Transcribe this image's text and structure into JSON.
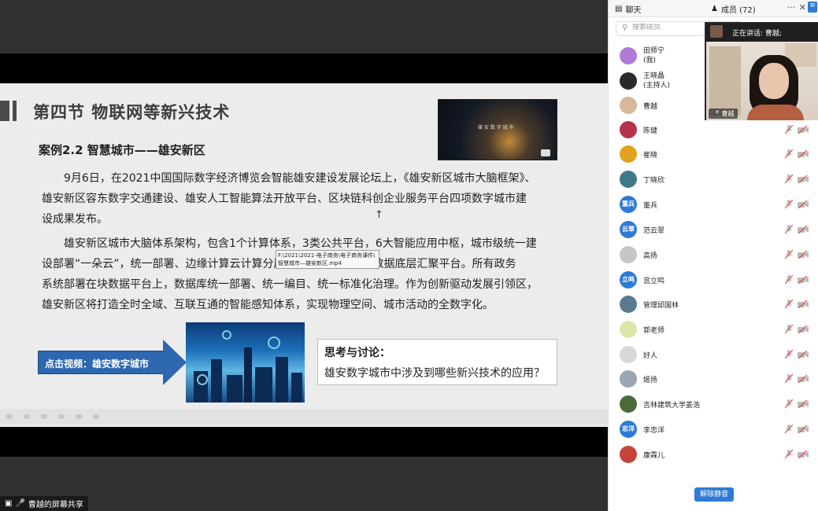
{
  "share": {
    "slide": {
      "title": "第四节 物联网等新兴技术",
      "case_title": "案例2.2  智慧城市——雄安新区",
      "para1_lines": [
        "9月6日，在2021中国国际数字经济博览会智能雄安建设发展论坛上，《雄安新区城市大脑框架》、",
        "雄安新区容东数字交通建设、雄安人工智能算法开放平台、区块链科创企业服务平台四项数字城市建",
        "设成果发布。"
      ],
      "para2_lines": [
        "雄安新区城市大脑体系架构，包含1个计算体系，3类公共平台，6大智能应用中枢，城市级统一建",
        "设部署“一朵云”，统一部署、边缘计算云计算分层协同，全域统一的数据底层汇聚平台。所有政务",
        "系统部署在块数据平台上，数据库统一部署、统一编目、统一标准化治理。作为创新驱动发展引领区，",
        "雄安新区将打造全时全域、互联互通的智能感知体系，实现物理空间、城市活动的全数字化。"
      ],
      "thumb_label": "雄 安 数 字 城 市",
      "tooltip_lines": [
        "F:\\2021\\2021-电子商务\\电子商务课件\\",
        "智慧城市—雄安新区.mp4"
      ],
      "video_button": "点击视频：雄安数字城市",
      "think_title": "思考与讨论：",
      "think_text": "雄安数字城市中涉及到哪些新兴技术的应用？"
    },
    "status_label": "曹越的屏幕共享"
  },
  "panel": {
    "tab_chat": "聊天",
    "tab_members": "成员 (72)",
    "more": "···",
    "close": "✕",
    "search_placeholder": "搜索成员",
    "unmute_button": "解除静音",
    "speaking_label": "正在讲话: 曹越;",
    "video_name": "曹越",
    "members": [
      {
        "name": "田师宁",
        "sub": "(我)",
        "avatar_text": "",
        "color": "#b07ad6"
      },
      {
        "name": "王晓晶",
        "sub": "(主持人)",
        "avatar_text": "",
        "color": "#2a2a2a"
      },
      {
        "name": "曹越",
        "sub": "",
        "avatar_text": "",
        "color": "#d7b899"
      },
      {
        "name": "陈健",
        "sub": "",
        "avatar_text": "",
        "color": "#b5334d"
      },
      {
        "name": "崔晓",
        "sub": "",
        "avatar_text": "",
        "color": "#e2a21b"
      },
      {
        "name": "丁晓欣",
        "sub": "",
        "avatar_text": "",
        "color": "#3c7a8a"
      },
      {
        "name": "董兵",
        "sub": "",
        "avatar_text": "董兵",
        "color": "#2d7bd6"
      },
      {
        "name": "范云翠",
        "sub": "",
        "avatar_text": "云翠",
        "color": "#2d7bd6"
      },
      {
        "name": "高扬",
        "sub": "",
        "avatar_text": "",
        "color": "#c6c6c6"
      },
      {
        "name": "宫立鸣",
        "sub": "",
        "avatar_text": "立鸣",
        "color": "#2d7bd6"
      },
      {
        "name": "管理邱国林",
        "sub": "",
        "avatar_text": "",
        "color": "#587a8c"
      },
      {
        "name": "郭老师",
        "sub": "",
        "avatar_text": "",
        "color": "#dfe5a8"
      },
      {
        "name": "好人",
        "sub": "",
        "avatar_text": "",
        "color": "#d8d8d8"
      },
      {
        "name": "姬扬",
        "sub": "",
        "avatar_text": "",
        "color": "#9aa6b0"
      },
      {
        "name": "吉林建筑大学姜浩",
        "sub": "",
        "avatar_text": "",
        "color": "#4c6b3a"
      },
      {
        "name": "李忠洋",
        "sub": "",
        "avatar_text": "忠洋",
        "color": "#2d7bd6"
      },
      {
        "name": "康霖儿",
        "sub": "",
        "avatar_text": "",
        "color": "#c4443c"
      }
    ]
  }
}
